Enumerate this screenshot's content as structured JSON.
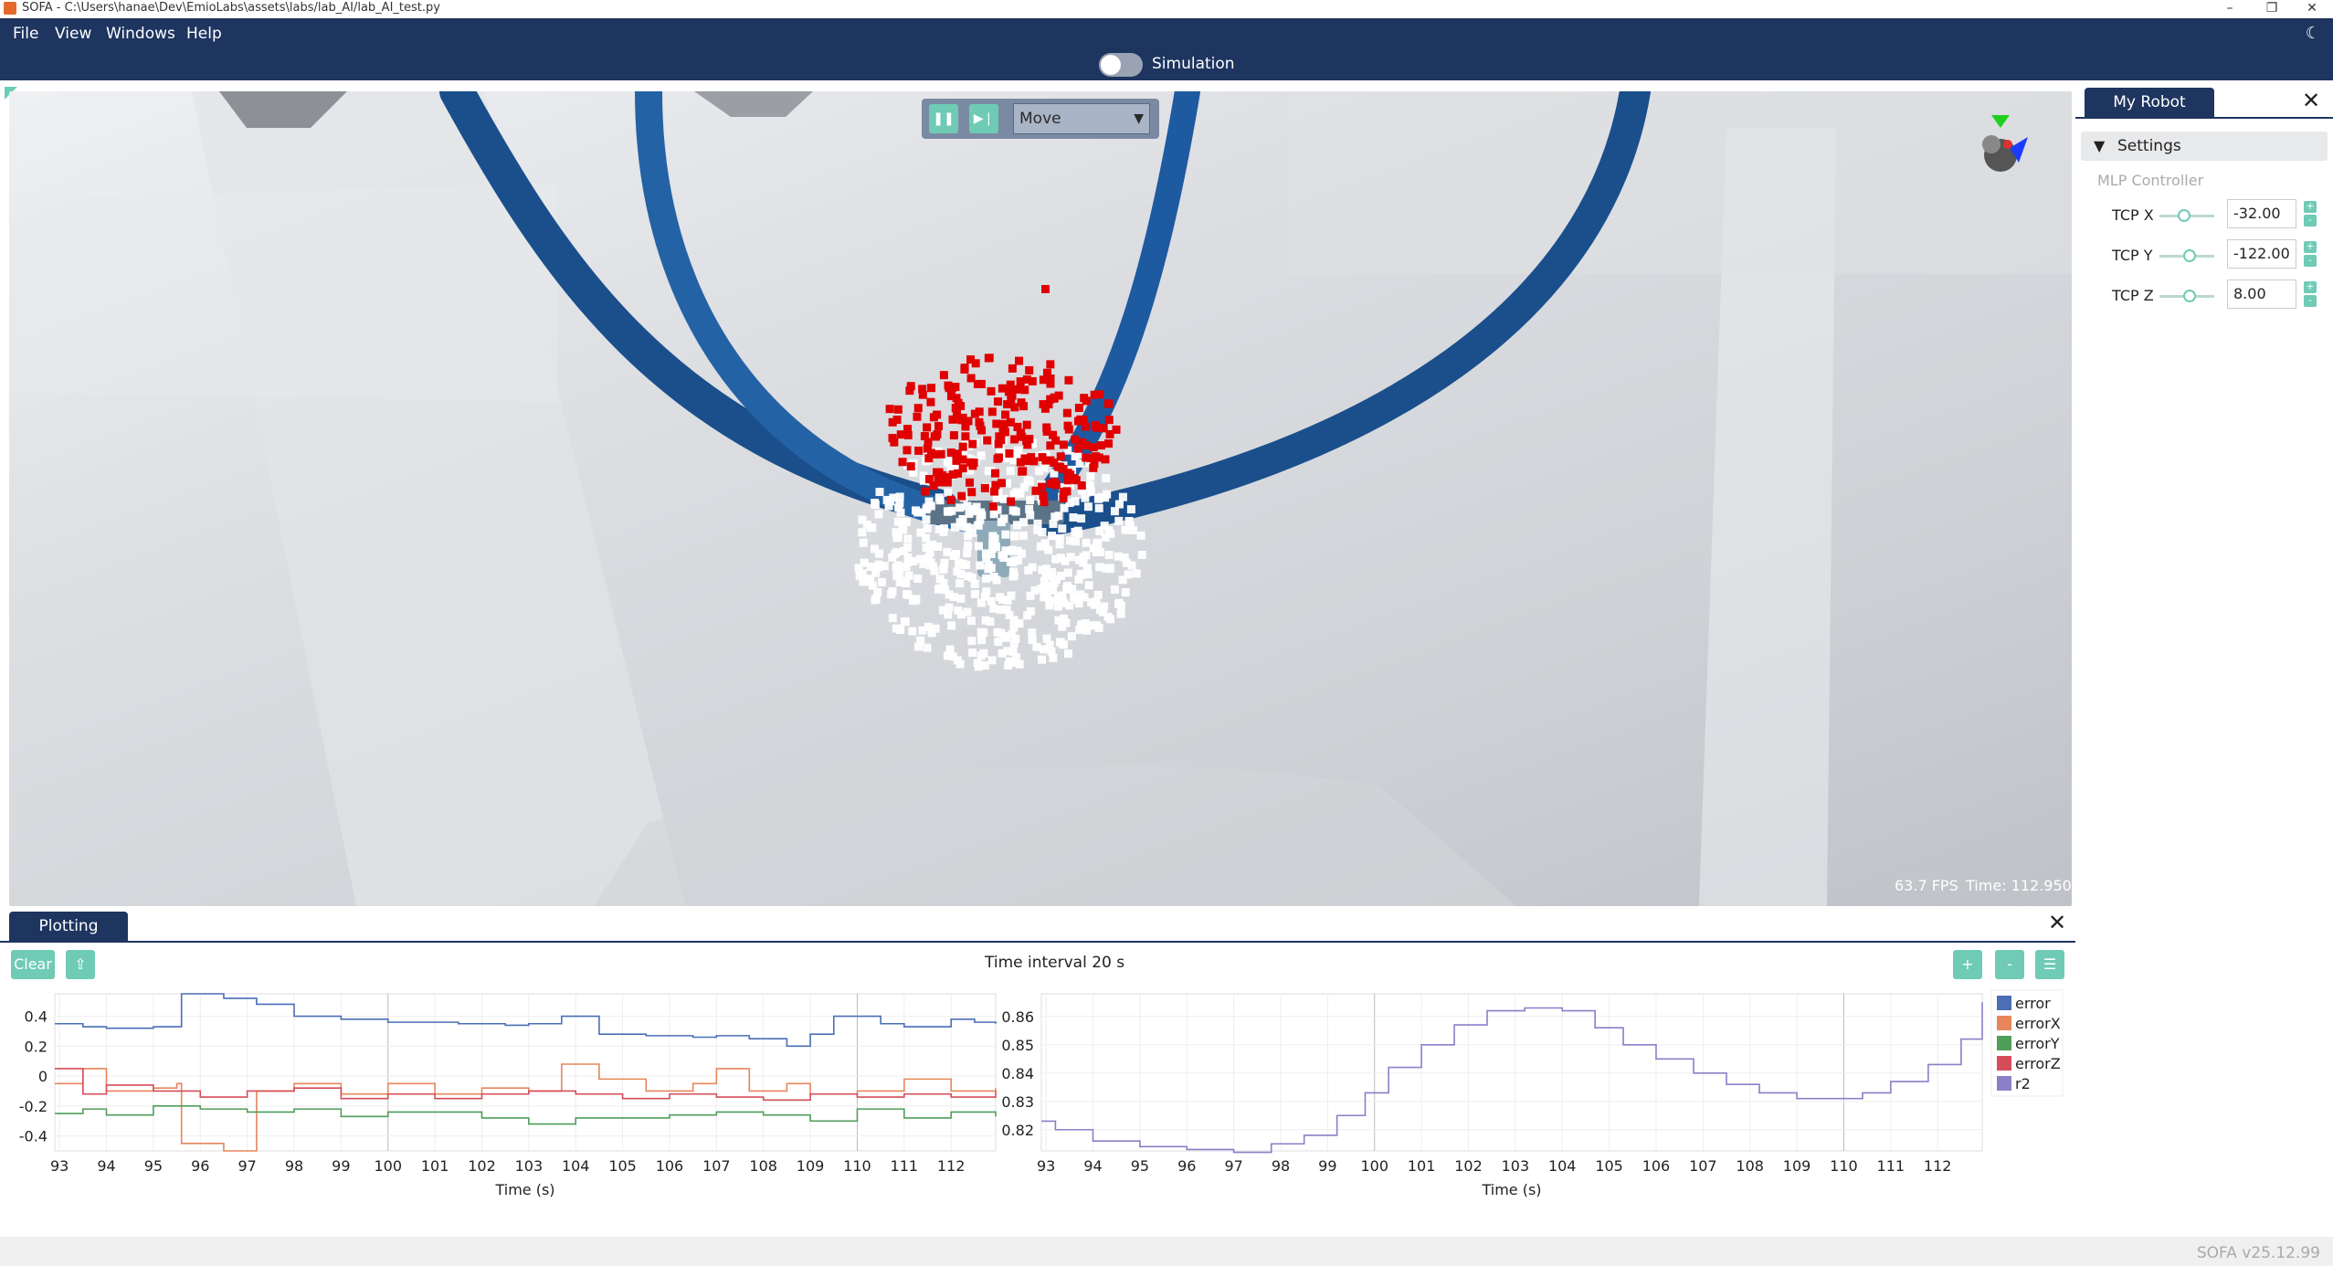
{
  "window": {
    "title": "SOFA - C:\\Users\\hanae\\Dev\\EmioLabs\\assets\\labs/lab_AI/lab_AI_test.py",
    "minimize": "–",
    "maximize": "❐",
    "close": "✕"
  },
  "menu": {
    "file": "File",
    "view": "View",
    "windows": "Windows",
    "help": "Help"
  },
  "simulation": {
    "label": "Simulation",
    "enabled": false
  },
  "viewport": {
    "mode": "Move",
    "fps": "63.7 FPS",
    "time": "Time: 112.950"
  },
  "robot_panel": {
    "tab": "My Robot",
    "settings": "Settings",
    "controller": "MLP Controller",
    "tcp": [
      {
        "label": "TCP X",
        "value": "-32.00",
        "slider": 0.45
      },
      {
        "label": "TCP Y",
        "value": "-122.00",
        "slider": 0.55
      },
      {
        "label": "TCP Z",
        "value": "8.00",
        "slider": 0.55
      }
    ]
  },
  "plotting": {
    "tab": "Plotting",
    "clear": "Clear",
    "interval": "Time interval 20 s",
    "plus": "+",
    "minus": "-"
  },
  "status": {
    "version": "SOFA v25.12.99"
  },
  "colors": {
    "accent": "#6fcbb5",
    "header": "#1e3560",
    "tube": "#1d5a9c",
    "marker_red": "#e00000"
  },
  "chart_data": [
    {
      "type": "line",
      "xlabel": "Time (s)",
      "ylabel": "",
      "xticks": [
        93,
        94,
        95,
        96,
        97,
        98,
        99,
        100,
        101,
        102,
        103,
        104,
        105,
        106,
        107,
        108,
        109,
        110,
        111,
        112
      ],
      "yticks": [
        "0.4",
        "0.2",
        "0",
        "-0.2",
        "-0.4"
      ],
      "xlim": [
        92.9,
        112.95
      ],
      "ylim": [
        -0.5,
        0.55
      ],
      "grid": true,
      "series": [
        {
          "name": "error",
          "color": "#4a6fb5",
          "x": [
            92.9,
            93.5,
            94,
            95,
            95.5,
            95.6,
            96.5,
            97.2,
            98,
            99,
            100,
            101.5,
            102.5,
            103,
            103.7,
            104.5,
            105.5,
            106.5,
            107,
            107.7,
            108.5,
            109,
            109.5,
            110.5,
            111,
            112,
            112.5,
            112.95
          ],
          "y": [
            0.35,
            0.33,
            0.32,
            0.33,
            0.33,
            0.55,
            0.52,
            0.48,
            0.4,
            0.38,
            0.36,
            0.35,
            0.34,
            0.35,
            0.4,
            0.28,
            0.27,
            0.26,
            0.27,
            0.25,
            0.2,
            0.28,
            0.4,
            0.35,
            0.33,
            0.38,
            0.36,
            0.35
          ]
        },
        {
          "name": "errorX",
          "color": "#e8855a",
          "x": [
            92.9,
            93.5,
            94,
            95,
            95.5,
            95.6,
            96.5,
            97.2,
            98,
            99,
            100,
            101,
            102,
            103,
            103.7,
            104.5,
            105.5,
            106.5,
            107,
            107.7,
            108.5,
            109,
            110,
            111,
            112,
            112.95
          ],
          "y": [
            -0.05,
            0.05,
            -0.1,
            -0.08,
            -0.05,
            -0.45,
            -0.5,
            -0.1,
            -0.05,
            -0.12,
            -0.05,
            -0.12,
            -0.08,
            -0.1,
            0.08,
            -0.02,
            -0.1,
            -0.05,
            0.05,
            -0.1,
            -0.05,
            -0.12,
            -0.1,
            -0.02,
            -0.1,
            -0.08
          ]
        },
        {
          "name": "errorY",
          "color": "#4f9e5a",
          "x": [
            92.9,
            93.5,
            94,
            95,
            96,
            97,
            98,
            99,
            100,
            101,
            102,
            103,
            104,
            105,
            106,
            107,
            108,
            109,
            110,
            111,
            112,
            112.95
          ],
          "y": [
            -0.25,
            -0.22,
            -0.26,
            -0.2,
            -0.22,
            -0.24,
            -0.22,
            -0.27,
            -0.24,
            -0.24,
            -0.28,
            -0.32,
            -0.28,
            -0.28,
            -0.26,
            -0.24,
            -0.26,
            -0.3,
            -0.22,
            -0.28,
            -0.24,
            -0.27
          ]
        },
        {
          "name": "errorZ",
          "color": "#d64c5a",
          "x": [
            92.9,
            93.5,
            94,
            95,
            96,
            97,
            98,
            99,
            100,
            101,
            102,
            103,
            104,
            105,
            106,
            107,
            108,
            109,
            110,
            111,
            112,
            112.95
          ],
          "y": [
            0.05,
            -0.12,
            -0.06,
            -0.1,
            -0.14,
            -0.1,
            -0.08,
            -0.15,
            -0.12,
            -0.15,
            -0.12,
            -0.1,
            -0.12,
            -0.15,
            -0.12,
            -0.14,
            -0.16,
            -0.12,
            -0.14,
            -0.12,
            -0.14,
            -0.1
          ]
        }
      ]
    },
    {
      "type": "line",
      "xlabel": "Time (s)",
      "ylabel": "",
      "xticks": [
        93,
        94,
        95,
        96,
        97,
        98,
        99,
        100,
        101,
        102,
        103,
        104,
        105,
        106,
        107,
        108,
        109,
        110,
        111,
        112
      ],
      "yticks": [
        "0.86",
        "0.85",
        "0.84",
        "0.83",
        "0.82"
      ],
      "xlim": [
        92.9,
        112.95
      ],
      "ylim": [
        0.8125,
        0.868
      ],
      "grid": true,
      "series": [
        {
          "name": "r2",
          "color": "#8c7fc8",
          "x": [
            92.9,
            93.2,
            94,
            95,
            96,
            97,
            97.8,
            98.5,
            99.2,
            99.8,
            100.3,
            101,
            101.7,
            102.4,
            103.2,
            104,
            104.7,
            105.3,
            106,
            106.8,
            107.5,
            108.2,
            109,
            109.7,
            110.4,
            111,
            111.8,
            112.5,
            112.95
          ],
          "y": [
            0.823,
            0.82,
            0.816,
            0.814,
            0.813,
            0.812,
            0.815,
            0.818,
            0.825,
            0.833,
            0.842,
            0.85,
            0.857,
            0.862,
            0.863,
            0.862,
            0.856,
            0.85,
            0.845,
            0.84,
            0.836,
            0.833,
            0.831,
            0.831,
            0.833,
            0.837,
            0.843,
            0.852,
            0.865
          ]
        }
      ]
    }
  ],
  "legend_labels": [
    "error",
    "errorX",
    "errorY",
    "errorZ",
    "r2"
  ]
}
